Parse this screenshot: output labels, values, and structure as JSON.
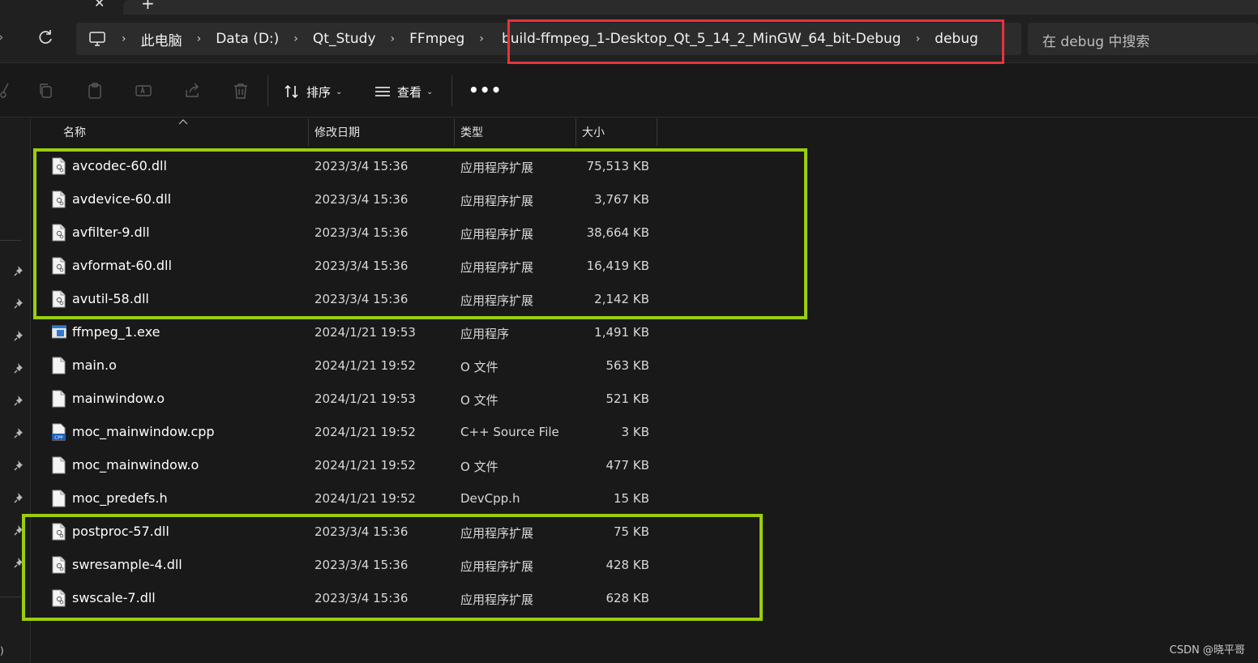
{
  "tabs": {
    "close_glyph": "✕",
    "new_tab_glyph": "+"
  },
  "address": {
    "crumbs": [
      "此电脑",
      "Data (D:)",
      "Qt_Study",
      "FFmpeg",
      "build-ffmpeg_1-Desktop_Qt_5_14_2_MinGW_64_bit-Debug",
      "debug"
    ],
    "separator": "›",
    "search_placeholder": "在 debug 中搜索"
  },
  "toolbar": {
    "sort_label": "排序",
    "view_label": "查看",
    "more_label": "•••",
    "dropdown_glyph": "⌄"
  },
  "columns": {
    "name": "名称",
    "modified": "修改日期",
    "type": "类型",
    "size": "大小"
  },
  "files": [
    {
      "name": "avcodec-60.dll",
      "date": "2023/3/4 15:36",
      "type": "应用程序扩展",
      "size": "75,513 KB",
      "icon": "dll-file-icon"
    },
    {
      "name": "avdevice-60.dll",
      "date": "2023/3/4 15:36",
      "type": "应用程序扩展",
      "size": "3,767 KB",
      "icon": "dll-file-icon"
    },
    {
      "name": "avfilter-9.dll",
      "date": "2023/3/4 15:36",
      "type": "应用程序扩展",
      "size": "38,664 KB",
      "icon": "dll-file-icon"
    },
    {
      "name": "avformat-60.dll",
      "date": "2023/3/4 15:36",
      "type": "应用程序扩展",
      "size": "16,419 KB",
      "icon": "dll-file-icon"
    },
    {
      "name": "avutil-58.dll",
      "date": "2023/3/4 15:36",
      "type": "应用程序扩展",
      "size": "2,142 KB",
      "icon": "dll-file-icon"
    },
    {
      "name": "ffmpeg_1.exe",
      "date": "2024/1/21 19:53",
      "type": "应用程序",
      "size": "1,491 KB",
      "icon": "exe-file-icon"
    },
    {
      "name": "main.o",
      "date": "2024/1/21 19:52",
      "type": "O 文件",
      "size": "563 KB",
      "icon": "blank-file-icon"
    },
    {
      "name": "mainwindow.o",
      "date": "2024/1/21 19:53",
      "type": "O 文件",
      "size": "521 KB",
      "icon": "blank-file-icon"
    },
    {
      "name": "moc_mainwindow.cpp",
      "date": "2024/1/21 19:52",
      "type": "C++ Source File",
      "size": "3 KB",
      "icon": "cpp-file-icon"
    },
    {
      "name": "moc_mainwindow.o",
      "date": "2024/1/21 19:52",
      "type": "O 文件",
      "size": "477 KB",
      "icon": "blank-file-icon"
    },
    {
      "name": "moc_predefs.h",
      "date": "2024/1/21 19:52",
      "type": "DevCpp.h",
      "size": "15 KB",
      "icon": "blank-file-icon"
    },
    {
      "name": "postproc-57.dll",
      "date": "2023/3/4 15:36",
      "type": "应用程序扩展",
      "size": "75 KB",
      "icon": "dll-file-icon"
    },
    {
      "name": "swresample-4.dll",
      "date": "2023/3/4 15:36",
      "type": "应用程序扩展",
      "size": "428 KB",
      "icon": "dll-file-icon"
    },
    {
      "name": "swscale-7.dll",
      "date": "2023/3/4 15:36",
      "type": "应用程序扩展",
      "size": "628 KB",
      "icon": "dll-file-icon"
    }
  ],
  "nav_partial_label": ":)",
  "watermark": "CSDN @晓平哥",
  "colors": {
    "background": "#191919",
    "highlight_red": "#e8333a",
    "highlight_green": "#9acd0f"
  }
}
